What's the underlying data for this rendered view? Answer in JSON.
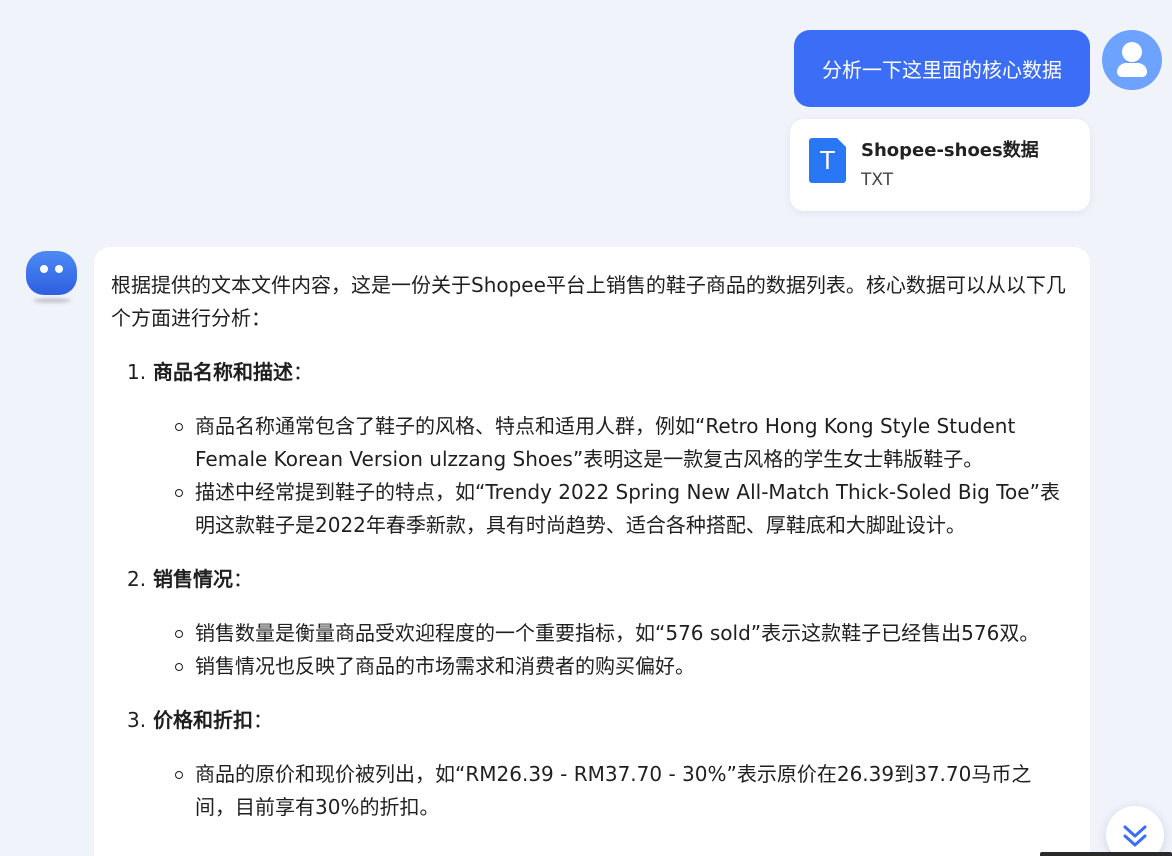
{
  "user_message": {
    "text": "分析一下这里面的核心数据",
    "attachment": {
      "name": "Shopee-shoes数据",
      "type": "TXT",
      "icon": "text-file-icon",
      "icon_letter": "T"
    }
  },
  "answer": {
    "intro": "根据提供的文本文件内容，这是一份关于Shopee平台上销售的鞋子商品的数据列表。核心数据可以从以下几个方面进行分析：",
    "sections": [
      {
        "number": "1.",
        "title": "商品名称和描述",
        "colon": "：",
        "bullets": [
          "商品名称通常包含了鞋子的风格、特点和适用人群，例如“Retro Hong Kong Style Student Female Korean Version ulzzang Shoes”表明这是一款复古风格的学生女士韩版鞋子。",
          "描述中经常提到鞋子的特点，如“Trendy 2022 Spring New All-Match Thick-Soled Big Toe”表明这款鞋子是2022年春季新款，具有时尚趋势、适合各种搭配、厚鞋底和大脚趾设计。"
        ]
      },
      {
        "number": "2.",
        "title": "销售情况",
        "colon": "：",
        "bullets": [
          "销售数量是衡量商品受欢迎程度的一个重要指标，如“576 sold”表示这款鞋子已经售出576双。",
          "销售情况也反映了商品的市场需求和消费者的购买偏好。"
        ]
      },
      {
        "number": "3.",
        "title": "价格和折扣",
        "colon": "：",
        "bullets": [
          "商品的原价和现价被列出，如“RM26.39 - RM37.70 - 30%”表示原价在26.39到37.70马币之间，目前享有30%的折扣。"
        ]
      }
    ]
  },
  "colors": {
    "accent": "#3b6df6",
    "file_icon": "#2977f5",
    "background": "#f0f3fa"
  }
}
